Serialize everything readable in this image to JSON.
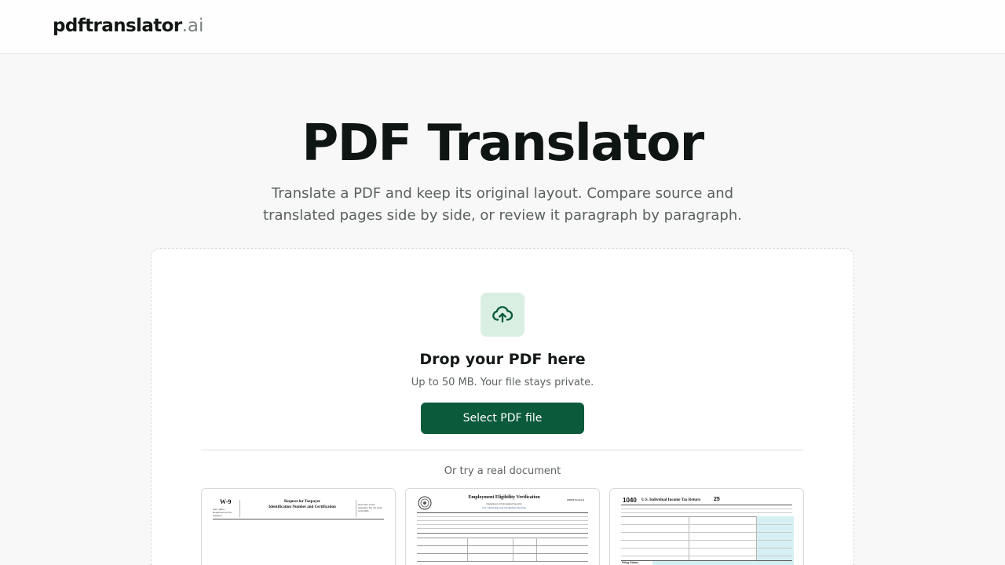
{
  "header": {
    "logo_main": "pdftranslator",
    "logo_tld": ".ai"
  },
  "hero": {
    "title": "PDF Translator",
    "subtitle": "Translate a PDF and keep its original layout. Compare source and translated pages side by side, or review it paragraph by paragraph."
  },
  "upload": {
    "icon": "cloud-upload-icon",
    "title": "Drop your PDF here",
    "subtitle": "Up to 50 MB. Your file stays private.",
    "button_label": "Select PDF file",
    "try_label": "Or try a real document"
  },
  "samples": [
    {
      "form": "W-9",
      "title_line1": "Request for Taxpayer",
      "title_line2": "Identification Number and Certification",
      "side_text": "Give form to the requester. Do not send to the IRS."
    },
    {
      "title": "Employment Eligibility Verification",
      "dept": "Department of Homeland Security",
      "agency": "U.S. Citizenship and Immigration Services",
      "form": "USCIS Form I-9"
    },
    {
      "form": "1040",
      "title": "U.S. Individual Income Tax Return",
      "year": "25",
      "section": "Filing Status"
    }
  ],
  "colors": {
    "accent": "#0b5a3c",
    "icon_bg": "#d9efe2",
    "form_1040_fill": "#d5f0f3"
  }
}
